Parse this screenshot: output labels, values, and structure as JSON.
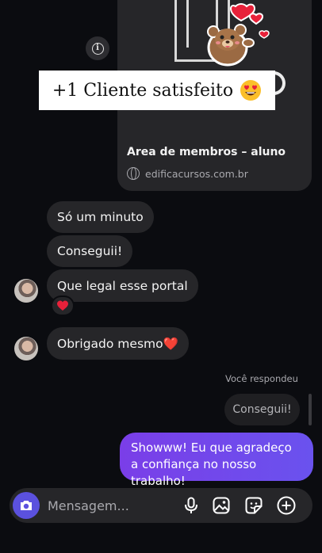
{
  "banner": {
    "text": "+1 Cliente satisfeito",
    "emoji": "smiling-face-with-heart-eyes-emoji"
  },
  "link_preview": {
    "title": "Area de membros – aluno",
    "domain": "edificacursos.com.br",
    "icon": "globe-icon"
  },
  "messages": [
    {
      "text": "Só um minuto"
    },
    {
      "text": "Conseguii!"
    },
    {
      "text": "Que legal esse portal"
    },
    {
      "text": "Obrigado mesmo❤️"
    }
  ],
  "reaction": {
    "icon": "red-heart-icon"
  },
  "reply": {
    "label": "Você respondeu",
    "quoted_text": "Conseguii!",
    "text": "Showww! Eu que agradeço a confiança no nosso trabalho!"
  },
  "composer": {
    "placeholder": "Mensagem...",
    "icons": [
      "camera-icon",
      "microphone-icon",
      "image-icon",
      "sticker-icon",
      "plus-icon"
    ]
  },
  "colors": {
    "background": "#0b0c10",
    "received_bubble": "#262629",
    "sent_bubble_start": "#7a3ee8",
    "sent_bubble_end": "#6a52ee",
    "accent": "#5b51de"
  }
}
